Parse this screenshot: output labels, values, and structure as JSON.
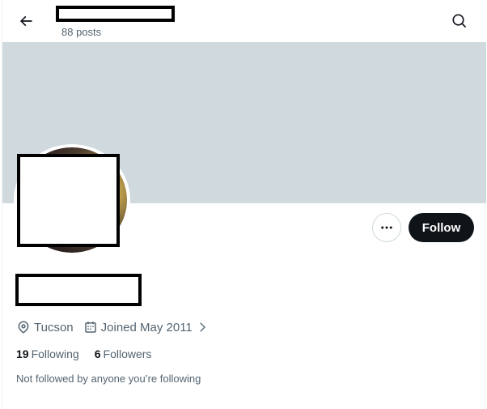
{
  "header": {
    "post_count": "88 posts",
    "back_icon": "arrow-left-icon",
    "search_icon": "search-icon"
  },
  "banner": {
    "color": "#cfd9de"
  },
  "actions": {
    "more_icon": "more-horizontal-icon",
    "follow_label": "Follow"
  },
  "profile": {
    "location": "Tucson",
    "joined": "Joined May 2011"
  },
  "stats": {
    "following_count": "19",
    "following_label": "Following",
    "followers_count": "6",
    "followers_label": "Followers"
  },
  "note": "Not followed by anyone you’re following"
}
